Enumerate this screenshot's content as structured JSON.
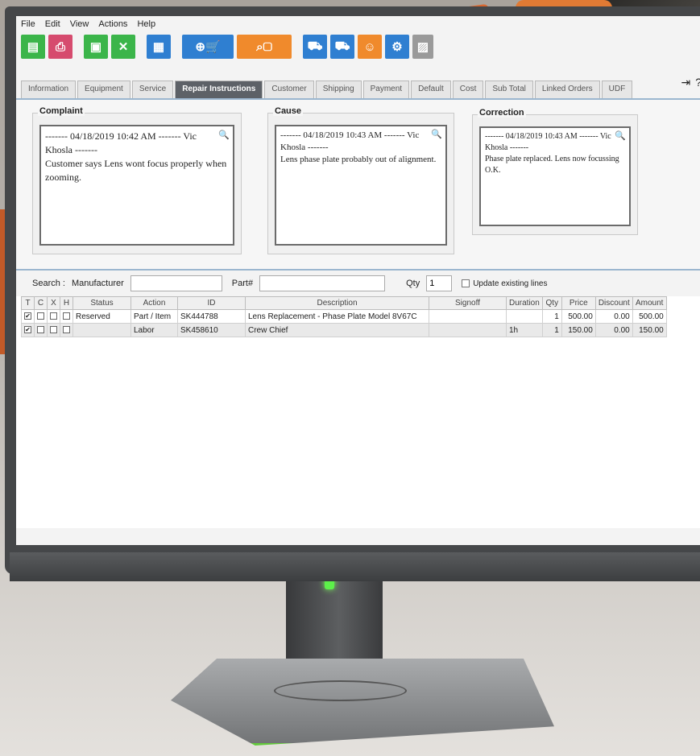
{
  "menu": [
    "File",
    "Edit",
    "View",
    "Actions",
    "Help"
  ],
  "toolbar": {
    "icons": [
      "new-document-icon",
      "print-icon",
      "save-icon",
      "close-x-icon",
      "grid-icon",
      "add-to-cart-icon",
      "search-box-icon",
      "truck-check-icon",
      "truck-icon",
      "smiley-icon",
      "wrench-icon",
      "disabled-icon"
    ]
  },
  "tabs": [
    "Information",
    "Equipment",
    "Service",
    "Repair Instructions",
    "Customer",
    "Shipping",
    "Payment",
    "Default",
    "Cost",
    "Sub Total",
    "Linked Orders",
    "UDF"
  ],
  "active_tab": "Repair Instructions",
  "header_icons": {
    "exit": "⇥",
    "help": "?"
  },
  "complaint": {
    "title": "Complaint",
    "line1": "------- 04/18/2019 10:42 AM ------- Vic",
    "line2": "Khosla -------",
    "body": "Customer says Lens wont focus properly when zooming."
  },
  "cause": {
    "title": "Cause",
    "line1": "------- 04/18/2019 10:43 AM ------- Vic",
    "line2": "Khosla -------",
    "body": "Lens phase plate probably out of alignment."
  },
  "correction": {
    "title": "Correction",
    "line1": "------- 04/18/2019 10:43 AM ------- Vic",
    "line2": "Khosla -------",
    "body": "Phase plate replaced. Lens now focussing O.K."
  },
  "search": {
    "label": "Search :",
    "manufacturer_label": "Manufacturer",
    "manufacturer_value": "",
    "part_label": "Part#",
    "part_value": "",
    "qty_label": "Qty",
    "qty_value": "1",
    "update_label": "Update existing lines"
  },
  "grid": {
    "columns": [
      "T",
      "C",
      "X",
      "H",
      "Status",
      "Action",
      "ID",
      "Description",
      "Signoff",
      "Duration",
      "Qty",
      "Price",
      "Discount",
      "Amount"
    ],
    "rows": [
      {
        "t": "✔",
        "status": "Reserved",
        "action": "Part / Item",
        "id": "SK444788",
        "description": "Lens Replacement - Phase Plate Model 8V67C",
        "signoff": "",
        "duration": "",
        "qty": "1",
        "price": "500.00",
        "discount": "0.00",
        "amount": "500.00"
      },
      {
        "t": "✔",
        "status": "",
        "action": "Labor",
        "id": "SK458610",
        "description": "Crew Chief",
        "signoff": "",
        "duration": "1h",
        "qty": "1",
        "price": "150.00",
        "discount": "0.00",
        "amount": "150.00"
      }
    ]
  }
}
